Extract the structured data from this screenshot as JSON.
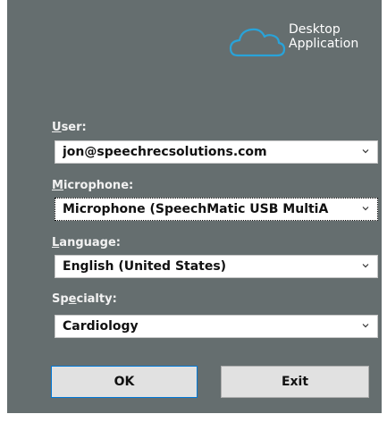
{
  "logo": {
    "icon": "cloud-icon",
    "line1": "Desktop",
    "line2": "Application"
  },
  "user": {
    "label_accel": "U",
    "label_rest": "ser:",
    "value": "jon@speechrecsolutions.com"
  },
  "microphone": {
    "label_accel": "M",
    "label_rest": "icrophone:",
    "value": "Microphone (SpeechMatic USB MultiA"
  },
  "language": {
    "label_accel": "L",
    "label_rest": "anguage:",
    "value": "English (United States)"
  },
  "specialty": {
    "label_before": "Sp",
    "label_accel": "e",
    "label_rest": "cialty:",
    "value": "Cardiology"
  },
  "buttons": {
    "ok": "OK",
    "exit": "Exit"
  },
  "colors": {
    "panel_bg": "#656e6f",
    "ok_border": "#0078d7"
  }
}
